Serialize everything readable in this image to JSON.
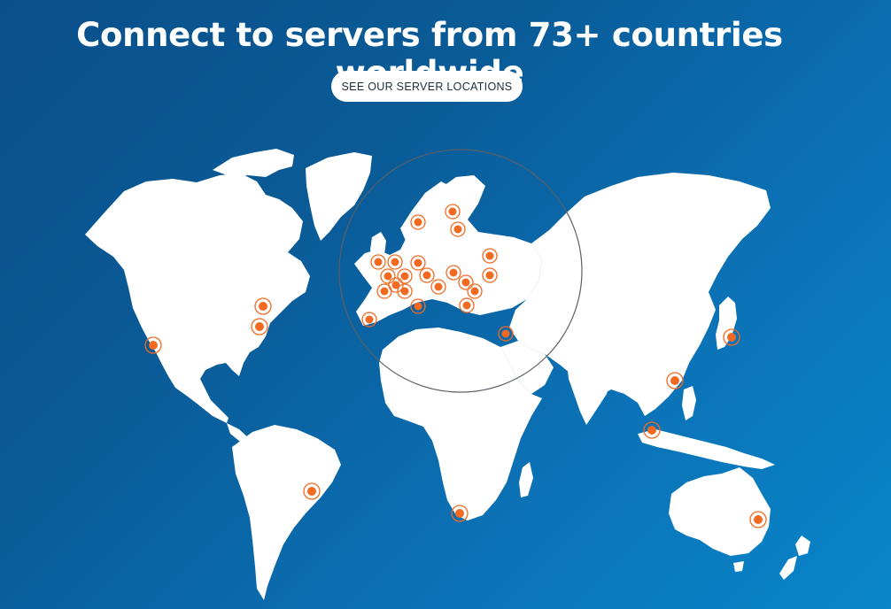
{
  "hero": {
    "headline": "Connect to servers from 73+ countries worldwide",
    "cta_label": "SEE OUR SERVER LOCATIONS"
  },
  "colors": {
    "background_dark": "#0a4f8a",
    "background_light": "#0a86c9",
    "land": "#ffffff",
    "marker": "#f26a21",
    "button": "#ffffff"
  },
  "map": {
    "icon": "world-map",
    "zoom_region": "europe-magnifier-circle",
    "marker_icon": "server-location-marker"
  }
}
